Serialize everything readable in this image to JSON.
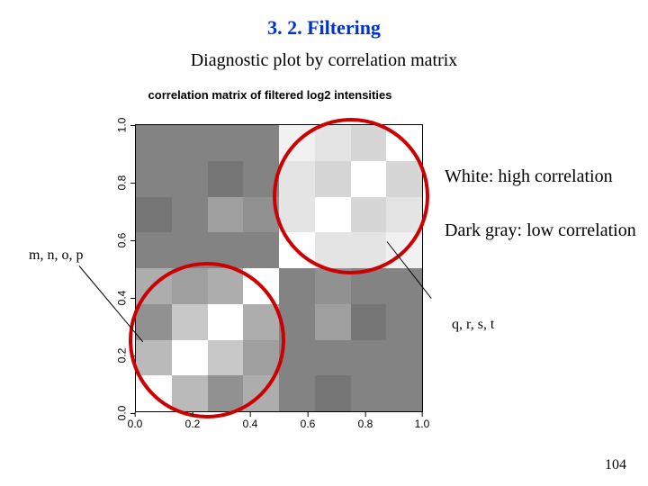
{
  "header": {
    "section_title": "3. 2. Filtering",
    "subtitle": "Diagnostic plot by correlation matrix"
  },
  "legend": {
    "white": "White: high correlation",
    "dark": "Dark gray: low correlation"
  },
  "labels": {
    "mnop": "m, n, o, p",
    "qrst": "q, r, s, t"
  },
  "footer": {
    "page_number": "104"
  },
  "chart_data": {
    "type": "heatmap",
    "title": "correlation matrix of\nfiltered log2 intensities",
    "xlabel": "",
    "ylabel": "",
    "x_ticks": [
      "0.0",
      "0.2",
      "0.4",
      "0.6",
      "0.8",
      "1.0"
    ],
    "y_ticks": [
      "0.0",
      "0.2",
      "0.4",
      "0.6",
      "0.8",
      "1.0"
    ],
    "xlim": [
      0,
      1
    ],
    "ylim": [
      0,
      1
    ],
    "samples": [
      "m",
      "n",
      "o",
      "p",
      "q",
      "r",
      "s",
      "t"
    ],
    "highlighted_clusters": [
      {
        "name": "m,n,o,p",
        "rows": [
          0,
          1,
          2,
          3
        ],
        "cols": [
          0,
          1,
          2,
          3
        ]
      },
      {
        "name": "q,r,s,t",
        "rows": [
          4,
          5,
          6,
          7
        ],
        "cols": [
          4,
          5,
          6,
          7
        ]
      }
    ],
    "value_scale_note": "white ≈ 1.0 (high correlation); dark gray ≈ low correlation",
    "values": [
      [
        1.0,
        0.75,
        0.6,
        0.7,
        0.55,
        0.5,
        0.55,
        0.55
      ],
      [
        0.75,
        1.0,
        0.8,
        0.65,
        0.55,
        0.55,
        0.55,
        0.55
      ],
      [
        0.6,
        0.8,
        1.0,
        0.7,
        0.55,
        0.65,
        0.5,
        0.55
      ],
      [
        0.7,
        0.65,
        0.7,
        1.0,
        0.55,
        0.6,
        0.55,
        0.55
      ],
      [
        0.55,
        0.55,
        0.55,
        0.55,
        1.0,
        0.9,
        0.9,
        0.95
      ],
      [
        0.5,
        0.55,
        0.65,
        0.6,
        0.9,
        1.0,
        0.85,
        0.9
      ],
      [
        0.55,
        0.55,
        0.5,
        0.55,
        0.9,
        0.85,
        1.0,
        0.85
      ],
      [
        0.55,
        0.55,
        0.55,
        0.55,
        0.95,
        0.9,
        0.85,
        1.0
      ]
    ]
  }
}
